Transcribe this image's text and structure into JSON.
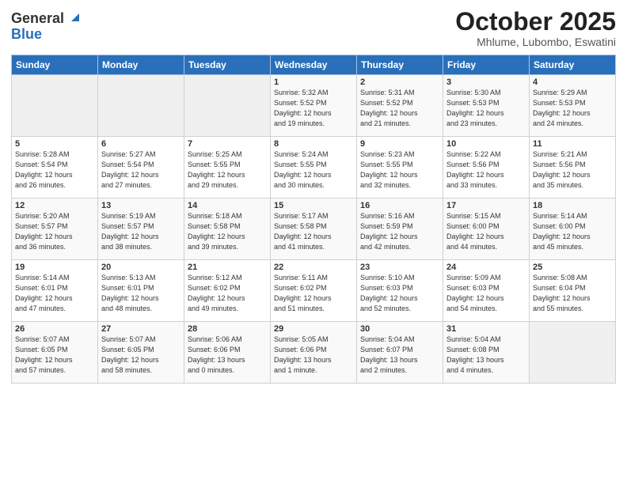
{
  "header": {
    "logo_general": "General",
    "logo_blue": "Blue",
    "month": "October 2025",
    "location": "Mhlume, Lubombo, Eswatini"
  },
  "days_of_week": [
    "Sunday",
    "Monday",
    "Tuesday",
    "Wednesday",
    "Thursday",
    "Friday",
    "Saturday"
  ],
  "weeks": [
    [
      {
        "day": "",
        "info": ""
      },
      {
        "day": "",
        "info": ""
      },
      {
        "day": "",
        "info": ""
      },
      {
        "day": "1",
        "info": "Sunrise: 5:32 AM\nSunset: 5:52 PM\nDaylight: 12 hours\nand 19 minutes."
      },
      {
        "day": "2",
        "info": "Sunrise: 5:31 AM\nSunset: 5:52 PM\nDaylight: 12 hours\nand 21 minutes."
      },
      {
        "day": "3",
        "info": "Sunrise: 5:30 AM\nSunset: 5:53 PM\nDaylight: 12 hours\nand 23 minutes."
      },
      {
        "day": "4",
        "info": "Sunrise: 5:29 AM\nSunset: 5:53 PM\nDaylight: 12 hours\nand 24 minutes."
      }
    ],
    [
      {
        "day": "5",
        "info": "Sunrise: 5:28 AM\nSunset: 5:54 PM\nDaylight: 12 hours\nand 26 minutes."
      },
      {
        "day": "6",
        "info": "Sunrise: 5:27 AM\nSunset: 5:54 PM\nDaylight: 12 hours\nand 27 minutes."
      },
      {
        "day": "7",
        "info": "Sunrise: 5:25 AM\nSunset: 5:55 PM\nDaylight: 12 hours\nand 29 minutes."
      },
      {
        "day": "8",
        "info": "Sunrise: 5:24 AM\nSunset: 5:55 PM\nDaylight: 12 hours\nand 30 minutes."
      },
      {
        "day": "9",
        "info": "Sunrise: 5:23 AM\nSunset: 5:55 PM\nDaylight: 12 hours\nand 32 minutes."
      },
      {
        "day": "10",
        "info": "Sunrise: 5:22 AM\nSunset: 5:56 PM\nDaylight: 12 hours\nand 33 minutes."
      },
      {
        "day": "11",
        "info": "Sunrise: 5:21 AM\nSunset: 5:56 PM\nDaylight: 12 hours\nand 35 minutes."
      }
    ],
    [
      {
        "day": "12",
        "info": "Sunrise: 5:20 AM\nSunset: 5:57 PM\nDaylight: 12 hours\nand 36 minutes."
      },
      {
        "day": "13",
        "info": "Sunrise: 5:19 AM\nSunset: 5:57 PM\nDaylight: 12 hours\nand 38 minutes."
      },
      {
        "day": "14",
        "info": "Sunrise: 5:18 AM\nSunset: 5:58 PM\nDaylight: 12 hours\nand 39 minutes."
      },
      {
        "day": "15",
        "info": "Sunrise: 5:17 AM\nSunset: 5:58 PM\nDaylight: 12 hours\nand 41 minutes."
      },
      {
        "day": "16",
        "info": "Sunrise: 5:16 AM\nSunset: 5:59 PM\nDaylight: 12 hours\nand 42 minutes."
      },
      {
        "day": "17",
        "info": "Sunrise: 5:15 AM\nSunset: 6:00 PM\nDaylight: 12 hours\nand 44 minutes."
      },
      {
        "day": "18",
        "info": "Sunrise: 5:14 AM\nSunset: 6:00 PM\nDaylight: 12 hours\nand 45 minutes."
      }
    ],
    [
      {
        "day": "19",
        "info": "Sunrise: 5:14 AM\nSunset: 6:01 PM\nDaylight: 12 hours\nand 47 minutes."
      },
      {
        "day": "20",
        "info": "Sunrise: 5:13 AM\nSunset: 6:01 PM\nDaylight: 12 hours\nand 48 minutes."
      },
      {
        "day": "21",
        "info": "Sunrise: 5:12 AM\nSunset: 6:02 PM\nDaylight: 12 hours\nand 49 minutes."
      },
      {
        "day": "22",
        "info": "Sunrise: 5:11 AM\nSunset: 6:02 PM\nDaylight: 12 hours\nand 51 minutes."
      },
      {
        "day": "23",
        "info": "Sunrise: 5:10 AM\nSunset: 6:03 PM\nDaylight: 12 hours\nand 52 minutes."
      },
      {
        "day": "24",
        "info": "Sunrise: 5:09 AM\nSunset: 6:03 PM\nDaylight: 12 hours\nand 54 minutes."
      },
      {
        "day": "25",
        "info": "Sunrise: 5:08 AM\nSunset: 6:04 PM\nDaylight: 12 hours\nand 55 minutes."
      }
    ],
    [
      {
        "day": "26",
        "info": "Sunrise: 5:07 AM\nSunset: 6:05 PM\nDaylight: 12 hours\nand 57 minutes."
      },
      {
        "day": "27",
        "info": "Sunrise: 5:07 AM\nSunset: 6:05 PM\nDaylight: 12 hours\nand 58 minutes."
      },
      {
        "day": "28",
        "info": "Sunrise: 5:06 AM\nSunset: 6:06 PM\nDaylight: 13 hours\nand 0 minutes."
      },
      {
        "day": "29",
        "info": "Sunrise: 5:05 AM\nSunset: 6:06 PM\nDaylight: 13 hours\nand 1 minute."
      },
      {
        "day": "30",
        "info": "Sunrise: 5:04 AM\nSunset: 6:07 PM\nDaylight: 13 hours\nand 2 minutes."
      },
      {
        "day": "31",
        "info": "Sunrise: 5:04 AM\nSunset: 6:08 PM\nDaylight: 13 hours\nand 4 minutes."
      },
      {
        "day": "",
        "info": ""
      }
    ]
  ]
}
